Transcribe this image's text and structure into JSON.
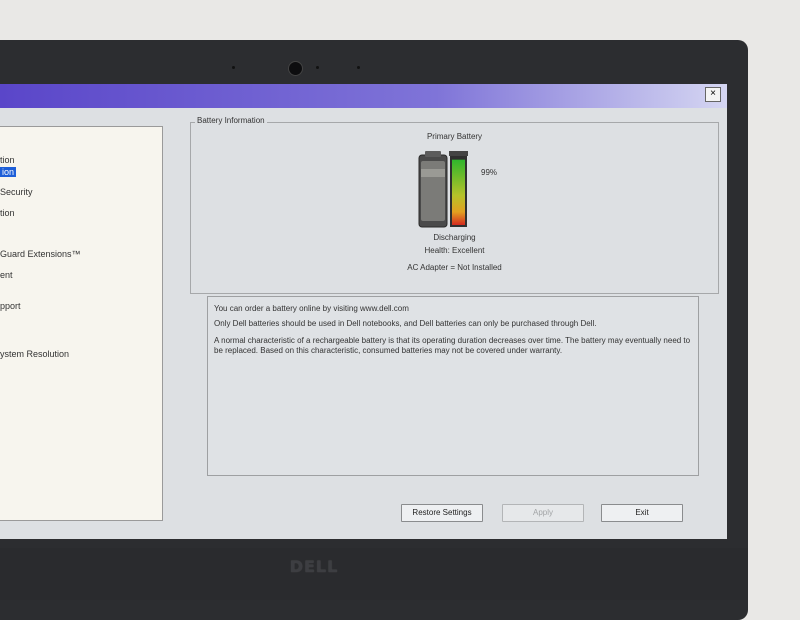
{
  "window": {
    "close_label": "×"
  },
  "nav": {
    "items": [
      {
        "label": "tion"
      },
      {
        "label": "ion"
      },
      {
        "label": "Security"
      },
      {
        "label": "tion"
      },
      {
        "label": "Guard Extensions™"
      },
      {
        "label": "ent"
      },
      {
        "label": "pport"
      },
      {
        "label": "ystem Resolution"
      }
    ]
  },
  "battery_info": {
    "group_label": "Battery Information",
    "primary_label": "Primary Battery",
    "percent_label": "99%",
    "charge_level": 0.99,
    "status": "Discharging",
    "health": "Health: Excellent",
    "ac_adapter": "AC Adapter = Not Installed"
  },
  "info_text": {
    "line1": "You can order a battery online by visiting www.dell.com",
    "line2": "Only Dell batteries should be used in Dell notebooks, and Dell batteries can only be purchased through Dell.",
    "line3": "A normal characteristic of a rechargeable battery is that its operating duration decreases over time.  The battery may eventually need to be replaced.  Based on this characteristic, consumed batteries may not be covered under warranty."
  },
  "buttons": {
    "restore": "Restore Settings",
    "apply": "Apply",
    "exit": "Exit"
  },
  "device": {
    "logo": "DELL"
  }
}
